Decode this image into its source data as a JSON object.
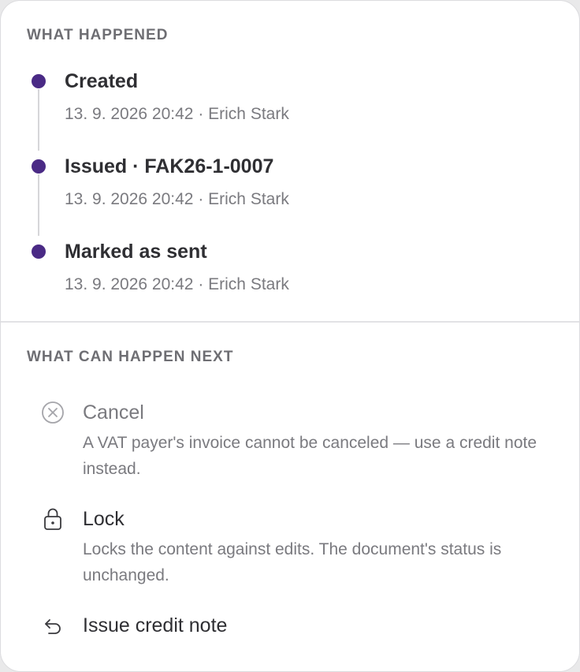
{
  "history": {
    "heading": "WHAT HAPPENED",
    "events": [
      {
        "title": "Created",
        "meta": "13. 9. 2026 20:42 · Erich Stark"
      },
      {
        "title": "Issued · FAK26-1-0007",
        "meta": "13. 9. 2026 20:42 · Erich Stark"
      },
      {
        "title": "Marked as sent",
        "meta": "13. 9. 2026 20:42 · Erich Stark"
      }
    ],
    "dot_color": "#4a2a85"
  },
  "next": {
    "heading": "WHAT CAN HAPPEN NEXT",
    "actions": [
      {
        "icon": "cancel-circle-icon",
        "title": "Cancel",
        "description": "A VAT payer's invoice cannot be canceled — use a credit note instead.",
        "enabled": false
      },
      {
        "icon": "lock-icon",
        "title": "Lock",
        "description": "Locks the content against edits. The document's status is unchanged.",
        "enabled": true
      },
      {
        "icon": "undo-arrow-icon",
        "title": "Issue credit note",
        "description": "",
        "enabled": true
      }
    ]
  }
}
